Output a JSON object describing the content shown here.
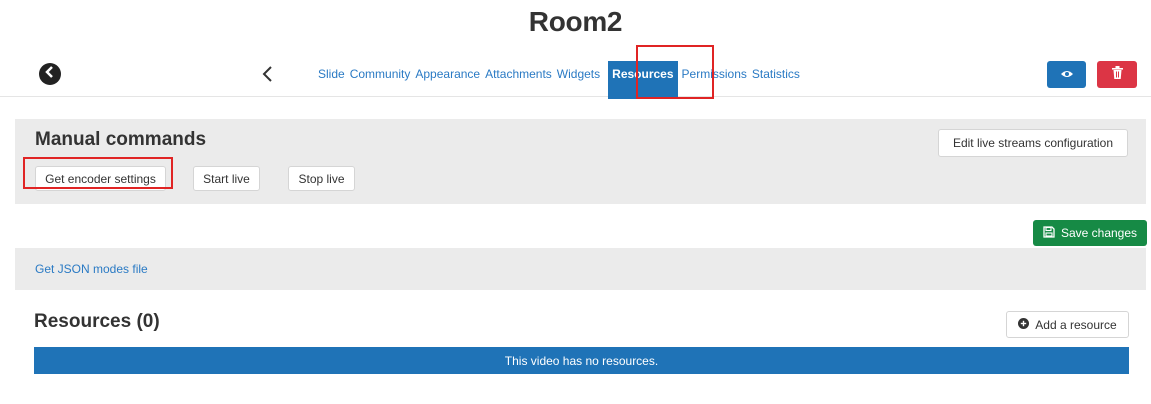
{
  "page": {
    "title": "Room2"
  },
  "nav": {
    "tabs": [
      {
        "label": "Slide"
      },
      {
        "label": "Community"
      },
      {
        "label": "Appearance"
      },
      {
        "label": "Attachments"
      },
      {
        "label": "Widgets"
      },
      {
        "label": "Resources",
        "active": true
      },
      {
        "label": "Permissions"
      },
      {
        "label": "Statistics"
      }
    ],
    "icons": {
      "back": "circle-arrow-left-icon",
      "prev": "chevron-left-icon",
      "view": "eye-icon",
      "delete": "trash-icon"
    }
  },
  "manual": {
    "title": "Manual commands",
    "buttons": {
      "get_encoder": "Get encoder settings",
      "start_live": "Start live",
      "stop_live": "Stop live",
      "edit_streams": "Edit live streams configuration"
    }
  },
  "save": {
    "label": "Save changes"
  },
  "json": {
    "link": "Get JSON modes file"
  },
  "resources": {
    "title": "Resources (0)",
    "add_label": "Add a resource",
    "empty_message": "This video has no resources."
  },
  "colors": {
    "primary": "#1f73b7",
    "danger": "#dc3545",
    "success": "#168a45",
    "link": "#2a7ac4",
    "panel": "#ebebeb",
    "highlight": "#e02424"
  }
}
